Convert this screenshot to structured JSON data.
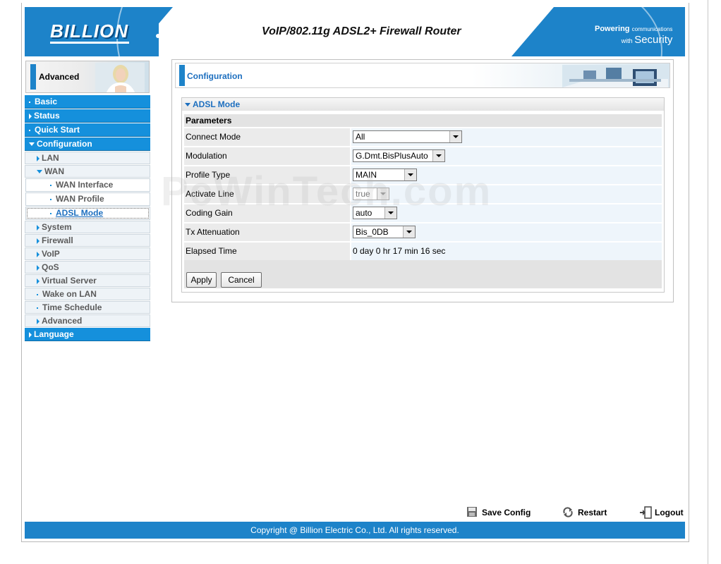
{
  "header": {
    "logo_text": "BILLION",
    "product_title": "VoIP/802.11g ADSL2+ Firewall Router",
    "slogan_line1_a": "Powering",
    "slogan_line1_b": "communications",
    "slogan_line2_a": "with",
    "slogan_line2_b": "Security",
    "brand_color": "#1d83c9"
  },
  "sidebar": {
    "mode_label": "Advanced",
    "menu": [
      {
        "label": "Basic",
        "level": "top",
        "icon": "bullet"
      },
      {
        "label": "Status",
        "level": "top",
        "icon": "triangle-right"
      },
      {
        "label": "Quick Start",
        "level": "top",
        "icon": "bullet"
      },
      {
        "label": "Configuration",
        "level": "top",
        "icon": "triangle-down"
      },
      {
        "label": "LAN",
        "level": "sub",
        "icon": "triangle-right"
      },
      {
        "label": "WAN",
        "level": "sub",
        "icon": "triangle-down"
      },
      {
        "label": "WAN Interface",
        "level": "subsub",
        "icon": "bullet"
      },
      {
        "label": "WAN Profile",
        "level": "subsub",
        "icon": "bullet"
      },
      {
        "label": "ADSL Mode",
        "level": "subsub",
        "icon": "bullet",
        "active": true
      },
      {
        "label": "System",
        "level": "sub",
        "icon": "triangle-right"
      },
      {
        "label": "Firewall",
        "level": "sub",
        "icon": "triangle-right"
      },
      {
        "label": "VoIP",
        "level": "sub",
        "icon": "triangle-right"
      },
      {
        "label": "QoS",
        "level": "sub",
        "icon": "triangle-right"
      },
      {
        "label": "Virtual Server",
        "level": "sub",
        "icon": "triangle-right"
      },
      {
        "label": "Wake on LAN",
        "level": "sub",
        "icon": "bullet"
      },
      {
        "label": "Time Schedule",
        "level": "sub",
        "icon": "bullet"
      },
      {
        "label": "Advanced",
        "level": "sub",
        "icon": "triangle-right"
      },
      {
        "label": "Language",
        "level": "top",
        "icon": "triangle-right"
      }
    ]
  },
  "main": {
    "section_title": "Configuration",
    "panel_title": "ADSL Mode",
    "params_heading": "Parameters",
    "rows": [
      {
        "label": "Connect Mode",
        "value": "All",
        "type": "select"
      },
      {
        "label": "Modulation",
        "value": "G.Dmt.BisPlusAuto",
        "type": "select"
      },
      {
        "label": "Profile Type",
        "value": "MAIN",
        "type": "select"
      },
      {
        "label": "Activate Line",
        "value": "true",
        "type": "select-disabled"
      },
      {
        "label": "Coding Gain",
        "value": "auto",
        "type": "select"
      },
      {
        "label": "Tx Attenuation",
        "value": "Bis_0DB",
        "type": "select"
      },
      {
        "label": "Elapsed Time",
        "value": "0 day 0 hr 17 min 16 sec",
        "type": "text"
      }
    ],
    "apply_label": "Apply",
    "cancel_label": "Cancel"
  },
  "watermark": "PcWinTech.com",
  "actions": {
    "save_config": "Save Config",
    "restart": "Restart",
    "logout": "Logout"
  },
  "footer": {
    "copyright": "Copyright @ Billion Electric Co., Ltd. All rights reserved."
  }
}
